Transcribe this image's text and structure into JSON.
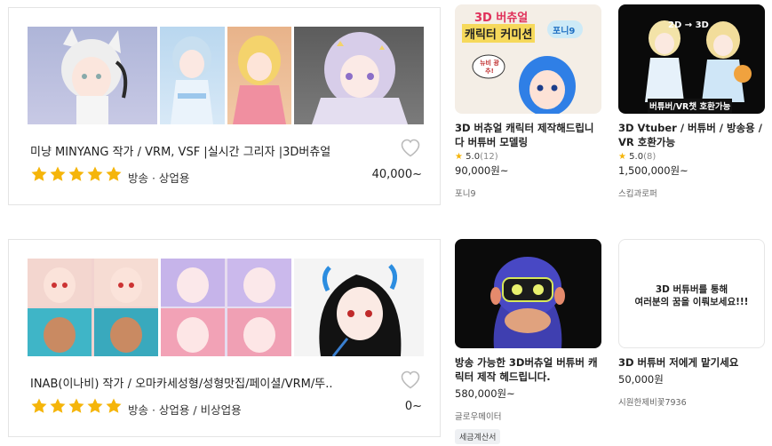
{
  "listings": [
    {
      "title": "미냥 MINYANG 작가  /  VRM, VSF |실시간 그리자 |3D버츄얼 |...",
      "usage": "방송 · 상업용",
      "price": "40,000~"
    },
    {
      "title": "INAB(이나비) 작가  /  오마카세성형/성형맛집/페이셜/VRM/뚜...",
      "usage": "방송 · 상업용 / 비상업용",
      "price": "0~"
    }
  ],
  "cards": [
    {
      "image_text": {
        "line1": "3D 버츄얼",
        "line2": "캐릭터 커미션",
        "tag": "포니9",
        "bubble": "뉴비 광추!"
      },
      "title": "3D 버츄얼 캐릭터 제작해드립니다 버튜버 모델링",
      "rating": "5.0",
      "rating_count": "(12)",
      "price": "90,000원~",
      "seller": "포니9"
    },
    {
      "image_text": {
        "arrow": "2D → 3D",
        "caption": "버튜버/VR챗 호환가능"
      },
      "title": "3D Vtuber / 버튜버 / 방송용 / VR 호환가능",
      "rating": "5.0",
      "rating_count": "(8)",
      "price": "1,500,000원~",
      "seller": "스킵과로퍼"
    },
    {
      "title": "방송 가능한 3D버츄얼 버튜버 캐릭터 제작 헤드립니다.",
      "price": "580,000원~",
      "seller": "글로우메이터",
      "badge": "세금계산서"
    },
    {
      "image_text": {
        "line1": "3D 버튜버를 통해",
        "line2": "여러분의 꿈을 이뤄보세요!!!"
      },
      "title": "3D 버튜버 저에게 맡기세요",
      "price": "50,000원",
      "seller": "시원한제비꽃7936"
    }
  ],
  "colors": {
    "star": "#f5b50a",
    "border": "#e4e4e4"
  }
}
